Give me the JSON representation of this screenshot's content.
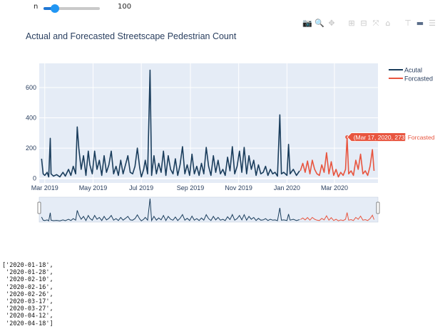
{
  "widget": {
    "label": "n",
    "value": "100",
    "min": 0,
    "max": 500
  },
  "modebar": {
    "buttons": [
      {
        "name": "camera-icon",
        "glyph": "📷",
        "state": "idle"
      },
      {
        "name": "zoom-icon",
        "glyph": "🔍",
        "state": "active"
      },
      {
        "name": "pan-icon",
        "glyph": "✥",
        "state": "idle"
      },
      {
        "name": "zoom-in-icon",
        "glyph": "⊞",
        "state": "idle"
      },
      {
        "name": "zoom-out-icon",
        "glyph": "⊟",
        "state": "idle"
      },
      {
        "name": "autoscale-icon",
        "glyph": "⤧",
        "state": "idle"
      },
      {
        "name": "reset-axes-icon",
        "glyph": "⌂",
        "state": "idle"
      },
      {
        "name": "spike-lines-icon",
        "glyph": "⊤",
        "state": "idle"
      },
      {
        "name": "hover-closest-icon",
        "glyph": "▬",
        "state": "active"
      },
      {
        "name": "hover-compare-icon",
        "glyph": "☰",
        "state": "idle"
      },
      {
        "name": "plotly-logo-icon",
        "glyph": "▥",
        "state": "logo"
      }
    ]
  },
  "colors": {
    "actual": "#1a3d5c",
    "forecast": "#e8553f",
    "plot_bg": "#e5ecf6",
    "grid": "#ffffff"
  },
  "hover": {
    "label": "(Mar 17, 2020, 273)",
    "series": "Forcasted"
  },
  "chart_data": {
    "type": "line",
    "title": "Actual and Forecasted Streetscape Pedestrian Count",
    "xlabel": "",
    "ylabel": "",
    "ylim": [
      -30,
      760
    ],
    "xlim": [
      "2019-02-22",
      "2020-04-25"
    ],
    "y_ticks": [
      0,
      200,
      400,
      600
    ],
    "x_ticks": [
      "2019-03-01",
      "2019-05-01",
      "2019-07-01",
      "2019-09-01",
      "2019-11-01",
      "2020-01-01",
      "2020-03-01"
    ],
    "x_tick_labels": [
      "Mar 2019",
      "May 2019",
      "Jul 2019",
      "Sep 2019",
      "Nov 2019",
      "Jan 2020",
      "Mar 2020"
    ],
    "legend": {
      "placement": "top-right"
    },
    "rangeslider": true,
    "series": [
      {
        "name": "Acutal",
        "points": [
          [
            "2019-02-25",
            130
          ],
          [
            "2019-02-27",
            30
          ],
          [
            "2019-03-01",
            20
          ],
          [
            "2019-03-04",
            40
          ],
          [
            "2019-03-06",
            10
          ],
          [
            "2019-03-08",
            265
          ],
          [
            "2019-03-09",
            30
          ],
          [
            "2019-03-12",
            15
          ],
          [
            "2019-03-16",
            25
          ],
          [
            "2019-03-20",
            10
          ],
          [
            "2019-03-24",
            40
          ],
          [
            "2019-03-27",
            15
          ],
          [
            "2019-03-31",
            60
          ],
          [
            "2019-04-03",
            20
          ],
          [
            "2019-04-06",
            80
          ],
          [
            "2019-04-09",
            30
          ],
          [
            "2019-04-11",
            340
          ],
          [
            "2019-04-13",
            200
          ],
          [
            "2019-04-16",
            60
          ],
          [
            "2019-04-19",
            150
          ],
          [
            "2019-04-22",
            20
          ],
          [
            "2019-04-25",
            180
          ],
          [
            "2019-04-27",
            90
          ],
          [
            "2019-04-30",
            30
          ],
          [
            "2019-05-03",
            180
          ],
          [
            "2019-05-06",
            60
          ],
          [
            "2019-05-09",
            120
          ],
          [
            "2019-05-12",
            20
          ],
          [
            "2019-05-15",
            150
          ],
          [
            "2019-05-18",
            40
          ],
          [
            "2019-05-21",
            90
          ],
          [
            "2019-05-24",
            180
          ],
          [
            "2019-05-27",
            30
          ],
          [
            "2019-05-30",
            80
          ],
          [
            "2019-06-02",
            20
          ],
          [
            "2019-06-05",
            120
          ],
          [
            "2019-06-08",
            30
          ],
          [
            "2019-06-11",
            90
          ],
          [
            "2019-06-14",
            150
          ],
          [
            "2019-06-17",
            40
          ],
          [
            "2019-06-20",
            30
          ],
          [
            "2019-06-23",
            80
          ],
          [
            "2019-06-26",
            200
          ],
          [
            "2019-06-29",
            70
          ],
          [
            "2019-07-01",
            10
          ],
          [
            "2019-07-04",
            60
          ],
          [
            "2019-07-06",
            120
          ],
          [
            "2019-07-09",
            30
          ],
          [
            "2019-07-12",
            715
          ],
          [
            "2019-07-14",
            20
          ],
          [
            "2019-07-17",
            150
          ],
          [
            "2019-07-20",
            30
          ],
          [
            "2019-07-23",
            100
          ],
          [
            "2019-07-26",
            40
          ],
          [
            "2019-07-29",
            180
          ],
          [
            "2019-08-01",
            20
          ],
          [
            "2019-08-04",
            150
          ],
          [
            "2019-08-07",
            60
          ],
          [
            "2019-08-10",
            30
          ],
          [
            "2019-08-13",
            130
          ],
          [
            "2019-08-16",
            20
          ],
          [
            "2019-08-19",
            90
          ],
          [
            "2019-08-22",
            210
          ],
          [
            "2019-08-25",
            30
          ],
          [
            "2019-08-28",
            90
          ],
          [
            "2019-08-31",
            20
          ],
          [
            "2019-09-03",
            160
          ],
          [
            "2019-09-06",
            30
          ],
          [
            "2019-09-09",
            80
          ],
          [
            "2019-09-12",
            20
          ],
          [
            "2019-09-15",
            100
          ],
          [
            "2019-09-18",
            30
          ],
          [
            "2019-09-21",
            205
          ],
          [
            "2019-09-24",
            80
          ],
          [
            "2019-09-27",
            20
          ],
          [
            "2019-09-30",
            150
          ],
          [
            "2019-10-03",
            40
          ],
          [
            "2019-10-06",
            120
          ],
          [
            "2019-10-09",
            30
          ],
          [
            "2019-10-12",
            60
          ],
          [
            "2019-10-15",
            20
          ],
          [
            "2019-10-18",
            140
          ],
          [
            "2019-10-21",
            50
          ],
          [
            "2019-10-24",
            210
          ],
          [
            "2019-10-27",
            30
          ],
          [
            "2019-10-30",
            80
          ],
          [
            "2019-11-02",
            180
          ],
          [
            "2019-11-05",
            40
          ],
          [
            "2019-11-08",
            205
          ],
          [
            "2019-11-11",
            30
          ],
          [
            "2019-11-14",
            150
          ],
          [
            "2019-11-17",
            60
          ],
          [
            "2019-11-20",
            120
          ],
          [
            "2019-11-23",
            20
          ],
          [
            "2019-11-26",
            90
          ],
          [
            "2019-11-29",
            30
          ],
          [
            "2019-12-02",
            40
          ],
          [
            "2019-12-05",
            80
          ],
          [
            "2019-12-08",
            20
          ],
          [
            "2019-12-11",
            60
          ],
          [
            "2019-12-14",
            30
          ],
          [
            "2019-12-17",
            40
          ],
          [
            "2019-12-20",
            15
          ],
          [
            "2019-12-23",
            420
          ],
          [
            "2019-12-25",
            30
          ],
          [
            "2019-12-28",
            40
          ],
          [
            "2020-01-01",
            20
          ],
          [
            "2020-01-03",
            225
          ],
          [
            "2020-01-05",
            30
          ],
          [
            "2020-01-09",
            60
          ],
          [
            "2020-01-13",
            20
          ],
          [
            "2020-01-17",
            50
          ]
        ]
      },
      {
        "name": "Forcasted",
        "points": [
          [
            "2020-01-18",
            50
          ],
          [
            "2020-01-21",
            100
          ],
          [
            "2020-01-24",
            40
          ],
          [
            "2020-01-27",
            115
          ],
          [
            "2020-01-30",
            30
          ],
          [
            "2020-02-02",
            120
          ],
          [
            "2020-02-05",
            60
          ],
          [
            "2020-02-08",
            30
          ],
          [
            "2020-02-11",
            20
          ],
          [
            "2020-02-14",
            90
          ],
          [
            "2020-02-17",
            40
          ],
          [
            "2020-02-20",
            170
          ],
          [
            "2020-02-23",
            30
          ],
          [
            "2020-02-26",
            110
          ],
          [
            "2020-02-29",
            20
          ],
          [
            "2020-03-03",
            60
          ],
          [
            "2020-03-06",
            10
          ],
          [
            "2020-03-09",
            40
          ],
          [
            "2020-03-12",
            20
          ],
          [
            "2020-03-15",
            60
          ],
          [
            "2020-03-17",
            273
          ],
          [
            "2020-03-19",
            30
          ],
          [
            "2020-03-22",
            50
          ],
          [
            "2020-03-25",
            20
          ],
          [
            "2020-03-28",
            120
          ],
          [
            "2020-03-31",
            60
          ],
          [
            "2020-04-03",
            160
          ],
          [
            "2020-04-06",
            30
          ],
          [
            "2020-04-09",
            50
          ],
          [
            "2020-04-12",
            20
          ],
          [
            "2020-04-15",
            80
          ],
          [
            "2020-04-18",
            190
          ],
          [
            "2020-04-20",
            50
          ]
        ]
      }
    ]
  },
  "output": {
    "lines": [
      "['2020-01-18',",
      " '2020-01-28',",
      " '2020-02-10',",
      " '2020-02-16',",
      " '2020-02-26',",
      " '2020-03-17',",
      " '2020-03-27',",
      " '2020-04-12',",
      " '2020-04-18']"
    ]
  }
}
